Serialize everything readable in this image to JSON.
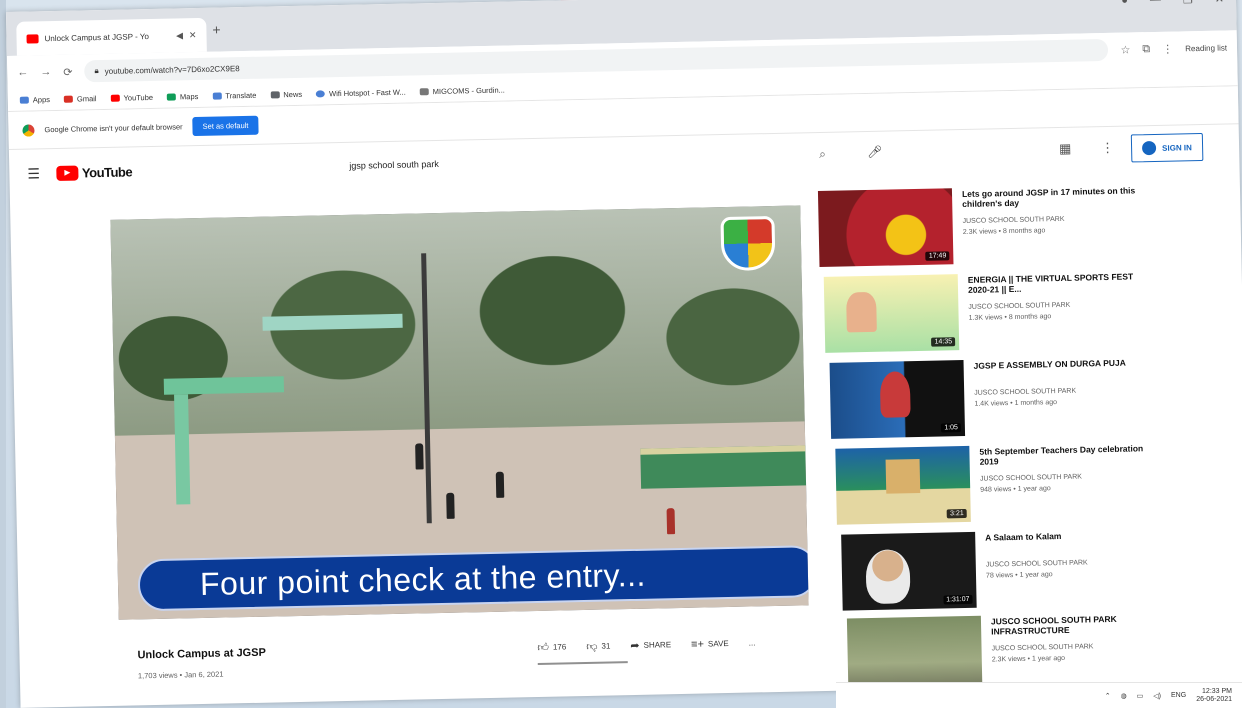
{
  "browser": {
    "tab_title": "Unlock Campus at JGSP - Yo",
    "address": "youtube.com/watch?v=7D6xo2CX9E8",
    "reading_list": "Reading list",
    "bookmarks": [
      {
        "label": "Apps"
      },
      {
        "label": "Gmail"
      },
      {
        "label": "YouTube"
      },
      {
        "label": "Maps"
      },
      {
        "label": "Translate"
      },
      {
        "label": "News"
      },
      {
        "label": "Wifi Hotspot - Fast W..."
      },
      {
        "label": "MIGCOMS - Gurdin..."
      }
    ],
    "infobar": {
      "message": "Google Chrome isn't your default browser",
      "button": "Set as default"
    }
  },
  "youtube": {
    "logo": "YouTube",
    "search_query": "jgsp school south park",
    "sign_in": "SIGN IN"
  },
  "video": {
    "caption": "Four point check at the entry...",
    "title": "Unlock Campus at JGSP",
    "meta": "1,703 views • Jan 6, 2021",
    "likes": "176",
    "dislikes": "31",
    "share": "SHARE",
    "save": "SAVE",
    "more": "..."
  },
  "recommendations": [
    {
      "title": "Lets go around JGSP in 17 minutes on this children's day",
      "channel": "JUSCO SCHOOL SOUTH PARK",
      "stats": "2.3K views • 8 months ago",
      "duration": "17:49"
    },
    {
      "title": "ENERGIA || THE VIRTUAL SPORTS FEST 2020-21 || E...",
      "channel": "JUSCO SCHOOL SOUTH PARK",
      "stats": "1.3K views • 8 months ago",
      "duration": "14:35"
    },
    {
      "title": "JGSP E ASSEMBLY ON DURGA PUJA",
      "channel": "JUSCO SCHOOL SOUTH PARK",
      "stats": "1.4K views • 1 months ago",
      "duration": "1:05"
    },
    {
      "title": "5th September Teachers Day celebration 2019",
      "channel": "JUSCO SCHOOL SOUTH PARK",
      "stats": "948 views • 1 year ago",
      "duration": "3:21"
    },
    {
      "title": "A Salaam to Kalam",
      "channel": "JUSCO SCHOOL SOUTH PARK",
      "stats": "78 views • 1 year ago",
      "duration": "1:31:07"
    },
    {
      "title": "JUSCO SCHOOL SOUTH PARK INFRASTRUCTURE",
      "channel": "JUSCO SCHOOL SOUTH PARK",
      "stats": "2.3K views • 1 year ago",
      "duration": ""
    }
  ],
  "tray": {
    "language": "ENG",
    "time": "12:33 PM",
    "date": "26-06-2021"
  }
}
